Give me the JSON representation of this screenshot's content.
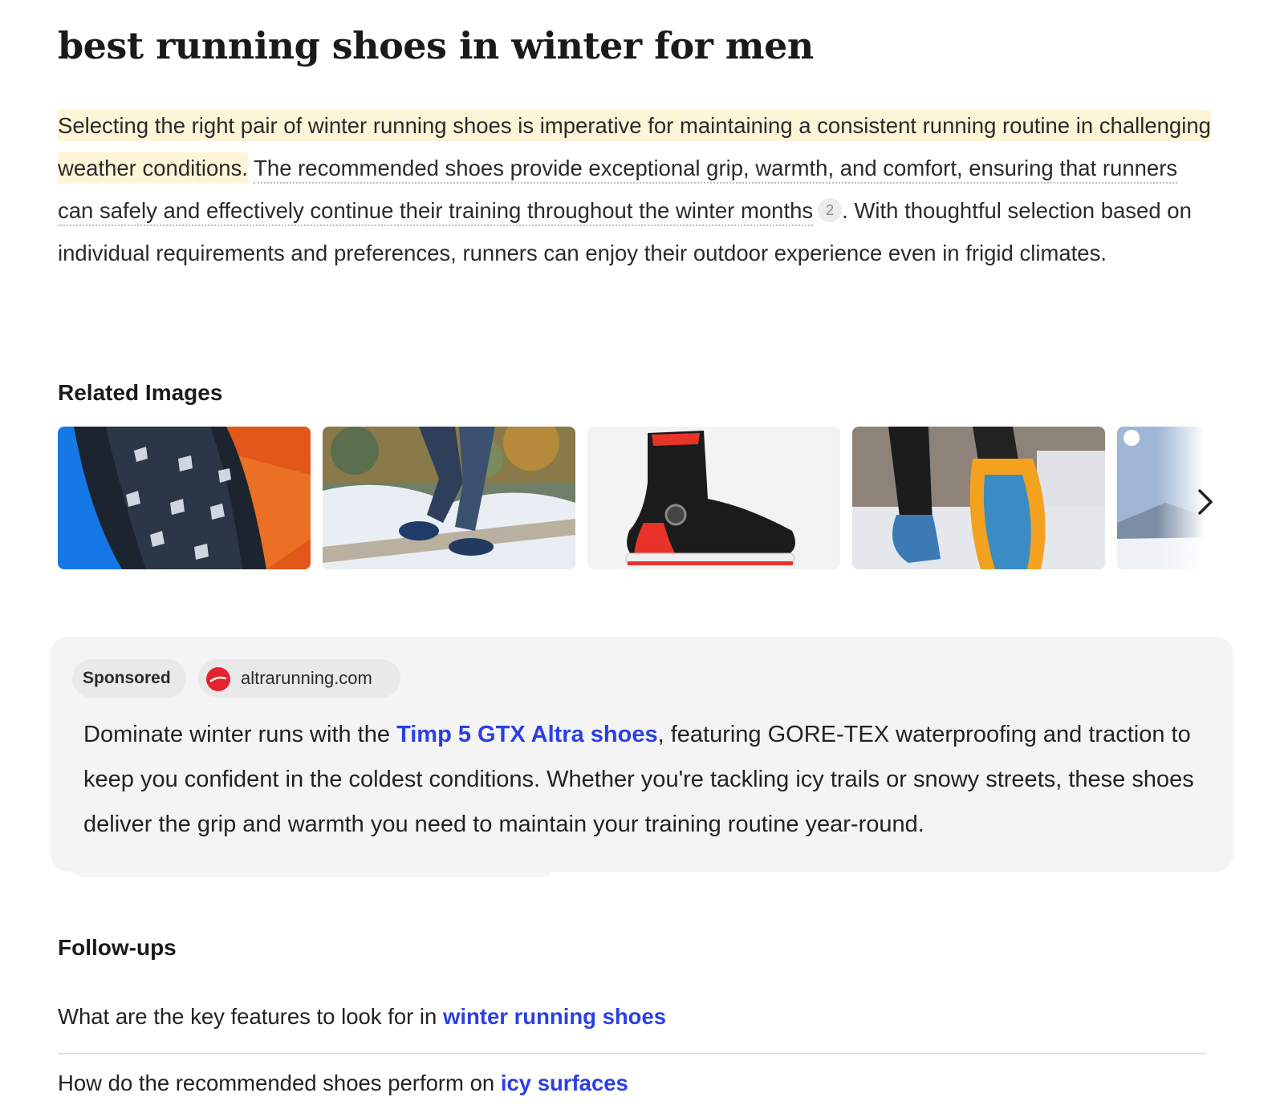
{
  "query": "best running shoes in winter for men",
  "answer": {
    "highlight": "Selecting the right pair of winter running shoes is imperative for maintaining a consistent running routine in challenging weather conditions.",
    "cited": "The recommended shoes provide exceptional grip, warmth, and comfort, ensuring that runners can safely and effectively continue their training throughout the winter months",
    "citation": "2",
    "period": ".",
    "rest": "With thoughtful selection based on individual requirements and preferences, runners can enjoy their outdoor experience even in frigid climates."
  },
  "related_images": {
    "heading": "Related Images",
    "items": [
      {
        "name": "trail-shoe-sole-spikes-image",
        "icon": "shoe-sole-photo"
      },
      {
        "name": "runner-on-snowy-path-image",
        "icon": "snow-running-photo"
      },
      {
        "name": "terrex-winter-boot-image",
        "icon": "boot-product-photo"
      },
      {
        "name": "runner-orange-sole-snow-image",
        "icon": "street-snow-photo"
      },
      {
        "name": "snowy-mountain-image",
        "icon": "mountain-photo"
      }
    ],
    "next_icon": "chevron-right-icon"
  },
  "sponsored": {
    "badge": "Sponsored",
    "advertiser": "altrarunning.com",
    "brand_color": "#e4232f",
    "text_before": "Dominate winter runs with the ",
    "link_text": "Timp 5 GTX Altra shoes",
    "text_after": ", featuring GORE-TEX waterproofing and traction to keep you confident in the coldest conditions. Whether you're tackling icy trails or snowy streets, these shoes deliver the grip and warmth you need to maintain your training routine year-round."
  },
  "followups": {
    "heading": "Follow-ups",
    "items": [
      {
        "prefix": "What are the key features to look for in ",
        "link": "winter running shoes"
      },
      {
        "prefix": "How do the recommended shoes perform on ",
        "link": "icy surfaces"
      }
    ]
  },
  "colors": {
    "link": "#2b3fe6",
    "highlight": "#fdf5d8",
    "card": "#f4f4f4"
  }
}
